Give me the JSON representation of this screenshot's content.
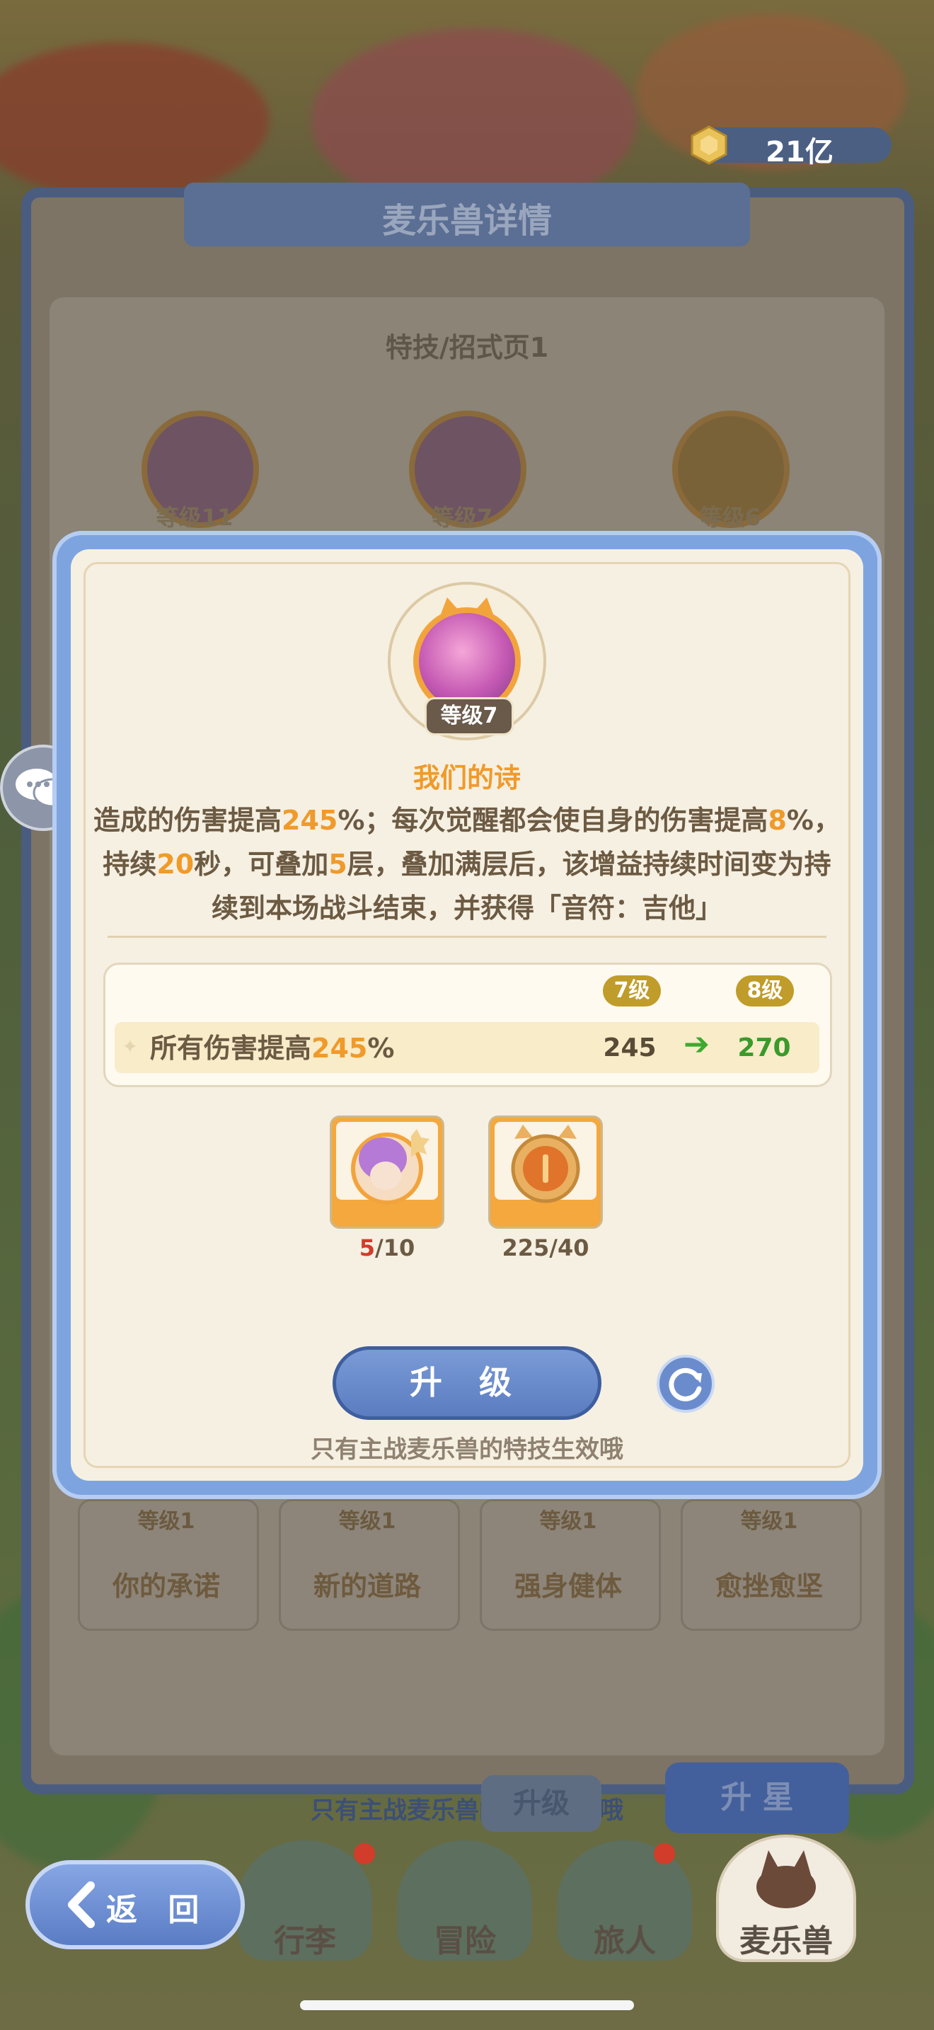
{
  "currency": {
    "amount": "21亿",
    "icon": "coin-icon"
  },
  "detail_panel": {
    "title": "麦乐兽详情",
    "tab_title": "特技/招式页1",
    "top_skills": [
      {
        "level": "等级11"
      },
      {
        "level": "等级7"
      },
      {
        "level": "等级6"
      }
    ],
    "bottom_skills": [
      {
        "level": "等级1",
        "name": "你的承诺"
      },
      {
        "level": "等级1",
        "name": "新的道路"
      },
      {
        "level": "等级1",
        "name": "强身健体"
      },
      {
        "level": "等级1",
        "name": "愈挫愈坚"
      }
    ],
    "bottom_hint": "只有主战麦乐兽的特技生效哦",
    "upgrade_label": "升级",
    "star_label": "升 星"
  },
  "modal": {
    "level_badge": "等级7",
    "skill_name": "我们的诗",
    "desc_parts": [
      {
        "t": "造成的伤害提高",
        "hl": false
      },
      {
        "t": "245",
        "hl": true
      },
      {
        "t": "%；每次觉醒都会使自身的伤害提高",
        "hl": false
      },
      {
        "t": "8",
        "hl": true
      },
      {
        "t": "%，持续",
        "hl": false
      },
      {
        "t": "20",
        "hl": true
      },
      {
        "t": "秒，可叠加",
        "hl": false
      },
      {
        "t": "5",
        "hl": true
      },
      {
        "t": "层，叠加满层后，该增益持续时间变为持续到本场战斗结束，并获得「音符：吉他」",
        "hl": false
      }
    ],
    "stats": {
      "current_level_label": "7级",
      "next_level_label": "8级",
      "label_prefix": "所有伤害提高",
      "label_value": "245",
      "label_suffix": "%",
      "current_value": "245",
      "next_value": "270"
    },
    "materials": [
      {
        "icon": "character-shard-icon",
        "have": "5",
        "need": "/10",
        "insufficient": true
      },
      {
        "icon": "cat-coin-icon",
        "have": "225",
        "need": "/40",
        "insufficient": false
      }
    ],
    "upgrade_button": "升 级",
    "hint": "只有主战麦乐兽的特技生效哦"
  },
  "nav": {
    "back_label": "返 回",
    "items": [
      {
        "label": "行李",
        "badge": true
      },
      {
        "label": "冒险",
        "badge": false
      },
      {
        "label": "旅人",
        "badge": true
      },
      {
        "label": "麦乐兽",
        "badge": false
      }
    ]
  },
  "colors": {
    "accent": "#f09a2a",
    "modal_frame": "#7ea4e0",
    "button": "#5b7cc0",
    "green": "#3a9a2a"
  }
}
